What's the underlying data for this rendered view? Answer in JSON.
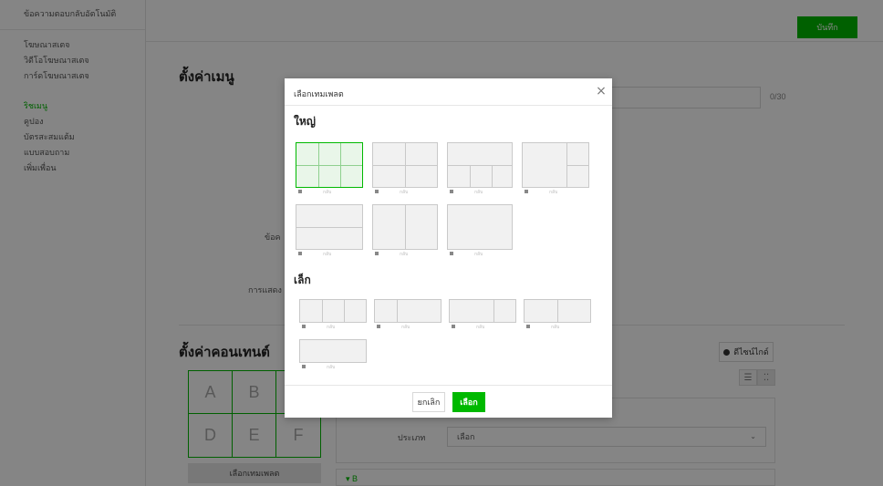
{
  "sidebar": {
    "top_label": "ข้อความตอบกลับอัตโนมัติ",
    "items_a": [
      {
        "label": "โฆษณาสเตจ"
      },
      {
        "label": "วิดีโอโฆษณาสเตจ"
      },
      {
        "label": "การ์ดโฆษณาสเตจ"
      }
    ],
    "items_b": [
      {
        "label": "ริชเมนู",
        "active": true
      },
      {
        "label": "คูปอง"
      },
      {
        "label": "บัตรสะสมแต้ม"
      },
      {
        "label": "แบบสอบถาม"
      },
      {
        "label": "เพิ่มเพื่อน"
      }
    ]
  },
  "topbar": {
    "save_label": "บันทึก"
  },
  "menu_settings": {
    "title": "ตั้งค่าเมนู",
    "char_count": "0/30",
    "label_1": "ข้อค",
    "label_2": "การแสดง"
  },
  "content_settings": {
    "title": "ตั้งค่าคอนเทนต์",
    "guide_label": "ดีไซน์ไกด์",
    "cells": [
      "A",
      "B",
      "C",
      "D",
      "E",
      "F"
    ],
    "choose_template_label": "เลือกเทมเพลต",
    "type_label": "ประเภท",
    "type_value": "เลือก",
    "bottom_label": "▾ B"
  },
  "modal": {
    "title": "เลือกเทมเพลต",
    "section_large": "ใหญ่",
    "section_small": "เล็ก",
    "tile_caption": "กลับ",
    "cancel_label": "ยกเลิก",
    "select_label": "เลือก"
  },
  "colors": {
    "accent": "#00b900",
    "overlay": "rgba(0,0,0,0.48)"
  },
  "icons": [
    "close-icon",
    "info-icon",
    "list-view-icon",
    "grid-view-icon",
    "chevron-down-icon"
  ]
}
